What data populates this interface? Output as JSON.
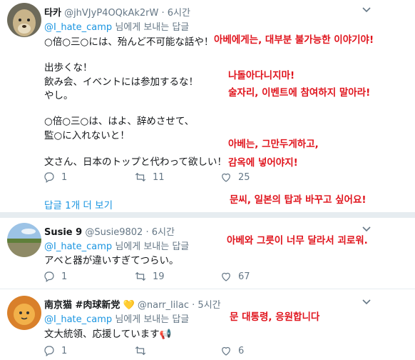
{
  "tweets": [
    {
      "name": "타카",
      "handle": "@jhVJyP4OQkAk2rW",
      "time": "6시간",
      "reply_prefix": "@I_hate_camp",
      "reply_suffix": "님에게 보내는 답글",
      "lines": [
        "○倍○三○には、殆んど不可能な話や！",
        "",
        "出歩くな！",
        "飲み会、イベントには参加するな！",
        "やし。",
        "",
        "○倍○三○は、はよ、辞めさせて、",
        "監○に入れないと！",
        "",
        "文さん、日本のトップと代わって欲しい！"
      ],
      "replies": "1",
      "retweets": "11",
      "likes": "25",
      "show_more": "답글 1개 더 보기"
    },
    {
      "name": "Susie 9",
      "handle": "@Susie9802",
      "time": "6시간",
      "reply_prefix": "@I_hate_camp",
      "reply_suffix": "님에게 보내는 답글",
      "lines": [
        "アベと器が違いすぎてつらい。"
      ],
      "replies": "1",
      "retweets": "19",
      "likes": "67"
    },
    {
      "name": "南京猫 #肉球新党",
      "handle": "@narr_lilac",
      "time": "5시간",
      "heart_emoji": "💛",
      "reply_prefix": "@I_hate_camp",
      "reply_suffix": "님에게 보내는 답글",
      "lines": [
        "文大統領、応援しています📢"
      ],
      "replies": "1",
      "retweets": "",
      "likes": "6"
    }
  ],
  "annotations": {
    "a1": "아베에게는, 대부분 불가능한 이야기야!",
    "a2": "나돌아다니지마!",
    "a3": "술자리, 이벤트에 참여하지 말아라!",
    "a4": "아베는, 그만두게하고,",
    "a5": "감옥에 넣어야지!",
    "a6": "문씨, 일본의 탑과 바꾸고 싶어요!",
    "a7": "아베와 그릇이 너무 달라서 괴로워.",
    "a8": "문 대통령, 응원합니다"
  },
  "colors": {
    "link": "#1b95e0",
    "annotation": "#e0141d",
    "muted": "#657786",
    "text": "#14171a"
  },
  "icons": [
    "reply-icon",
    "retweet-icon",
    "like-icon",
    "chevron-down-icon"
  ]
}
